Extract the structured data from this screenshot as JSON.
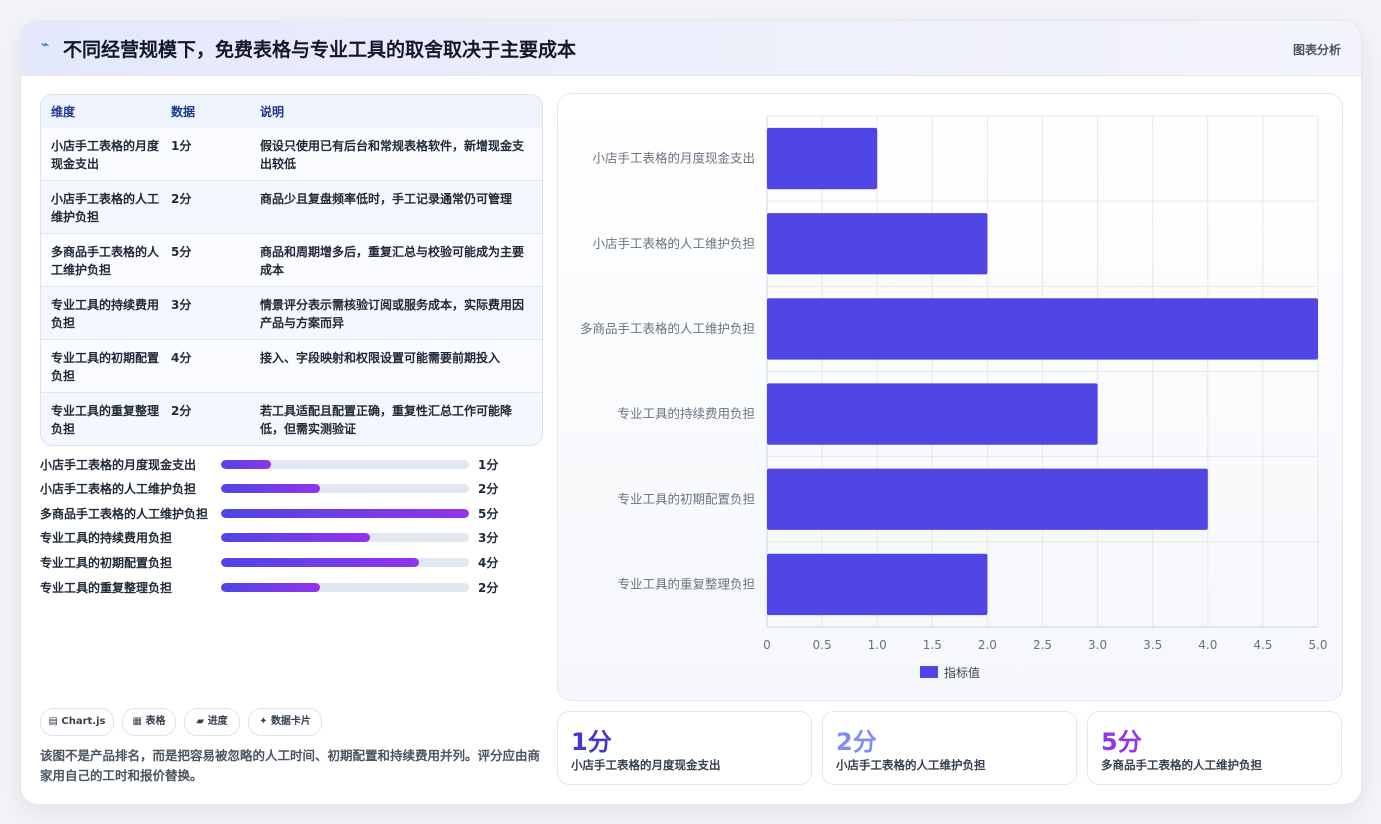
{
  "header": {
    "icon": "chart-line-icon",
    "title": "不同经营规模下，免费表格与专业工具的取舍取决于主要成本",
    "tag": "图表分析"
  },
  "table": {
    "headers": [
      "维度",
      "数据",
      "说明"
    ],
    "rows": [
      {
        "dim": "小店手工表格的月度现金支出",
        "val": "1分",
        "desc": "假设只使用已有后台和常规表格软件，新增现金支出较低"
      },
      {
        "dim": "小店手工表格的人工维护负担",
        "val": "2分",
        "desc": "商品少且复盘频率低时，手工记录通常仍可管理"
      },
      {
        "dim": "多商品手工表格的人工维护负担",
        "val": "5分",
        "desc": "商品和周期增多后，重复汇总与校验可能成为主要成本"
      },
      {
        "dim": "专业工具的持续费用负担",
        "val": "3分",
        "desc": "情景评分表示需核验订阅或服务成本，实际费用因产品与方案而异"
      },
      {
        "dim": "专业工具的初期配置负担",
        "val": "4分",
        "desc": "接入、字段映射和权限设置可能需要前期投入"
      },
      {
        "dim": "专业工具的重复整理负担",
        "val": "2分",
        "desc": "若工具适配且配置正确，重复性汇总工作可能降低，但需实测验证"
      }
    ]
  },
  "progress": [
    {
      "label": "小店手工表格的月度现金支出",
      "value": 1,
      "text": "1分"
    },
    {
      "label": "小店手工表格的人工维护负担",
      "value": 2,
      "text": "2分"
    },
    {
      "label": "多商品手工表格的人工维护负担",
      "value": 5,
      "text": "5分"
    },
    {
      "label": "专业工具的持续费用负担",
      "value": 3,
      "text": "3分"
    },
    {
      "label": "专业工具的初期配置负担",
      "value": 4,
      "text": "4分"
    },
    {
      "label": "专业工具的重复整理负担",
      "value": 2,
      "text": "2分"
    }
  ],
  "progress_max": 5,
  "chips": [
    {
      "icon": "chart-icon",
      "glyph": "▤",
      "label": "Chart.js"
    },
    {
      "icon": "table-icon",
      "glyph": "▦",
      "label": "表格"
    },
    {
      "icon": "progress-icon",
      "glyph": "▰",
      "label": "进度"
    },
    {
      "icon": "sparkle-icon",
      "glyph": "✦",
      "label": "数据卡片"
    }
  ],
  "note": "该图不是产品排名，而是把容易被忽略的人工时间、初期配置和持续费用并列。评分应由商家用自己的工时和报价替换。",
  "chart_data": {
    "type": "bar",
    "orientation": "horizontal",
    "categories": [
      "小店手工表格的月度现金支出",
      "小店手工表格的人工维护负担",
      "多商品手工表格的人工维护负担",
      "专业工具的持续费用负担",
      "专业工具的初期配置负担",
      "专业工具的重复整理负担"
    ],
    "series": [
      {
        "name": "指标值",
        "values": [
          1,
          2,
          5,
          3,
          4,
          2
        ]
      }
    ],
    "xlim": [
      0,
      5
    ],
    "xticks": [
      "0",
      "0.5",
      "1.0",
      "1.5",
      "2.0",
      "2.5",
      "3.0",
      "3.5",
      "4.0",
      "4.5",
      "5.0"
    ],
    "bar_color": "#4f46e5",
    "grid": true,
    "legend": "bottom"
  },
  "stats": [
    {
      "value": "1分",
      "label": "小店手工表格的月度现金支出",
      "color": "#4338ca"
    },
    {
      "value": "2分",
      "label": "小店手工表格的人工维护负担",
      "color": "#818cf8"
    },
    {
      "value": "5分",
      "label": "多商品手工表格的人工维护负担",
      "color": "#9333ea"
    }
  ]
}
